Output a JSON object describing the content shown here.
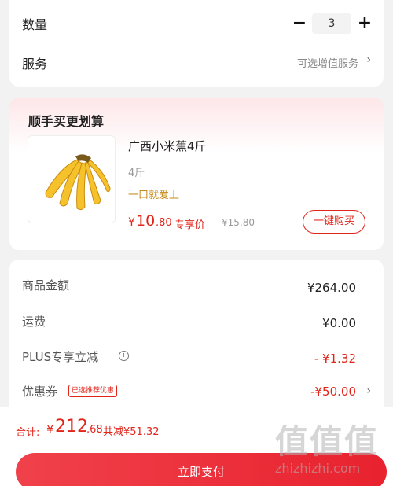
{
  "quantity": {
    "label": "数量",
    "minus": "−",
    "value": "3",
    "plus": "+"
  },
  "service": {
    "label": "服务",
    "hint": "可选增值服务",
    "chevron": "›"
  },
  "bundle": {
    "title": "顺手买更划算",
    "product": {
      "image_icon": "banana-bunch-image",
      "name": "广西小米蕉4斤",
      "spec": "4斤",
      "slogan": "一口就爱上",
      "price_currency": "¥",
      "price_int": "10",
      "price_dec": ".80",
      "price_tag": "专享价",
      "price_original": "¥15.80",
      "buy_label": "一键购买"
    }
  },
  "summary": {
    "rows": [
      {
        "label": "商品金额",
        "value": "¥264.00"
      },
      {
        "label": "运费",
        "value": "¥0.00"
      },
      {
        "label": "PLUS专享立减",
        "info": "i",
        "value": "- ¥1.32"
      },
      {
        "label": "优惠券",
        "badge": "已选推荐优惠",
        "value": "-¥50.00",
        "chevron": "›"
      }
    ]
  },
  "footer": {
    "total_label": "合计:",
    "total_currency": "¥",
    "total_int": "212",
    "total_dec": ".68",
    "saved": "共减¥51.32",
    "pay_label": "立即支付"
  },
  "watermark": {
    "big": "值值值",
    "small": "zhizhizhi.com"
  },
  "colors": {
    "accent": "#e1251b",
    "pay_button": "#e8222e",
    "slogan": "#c98a1b"
  }
}
